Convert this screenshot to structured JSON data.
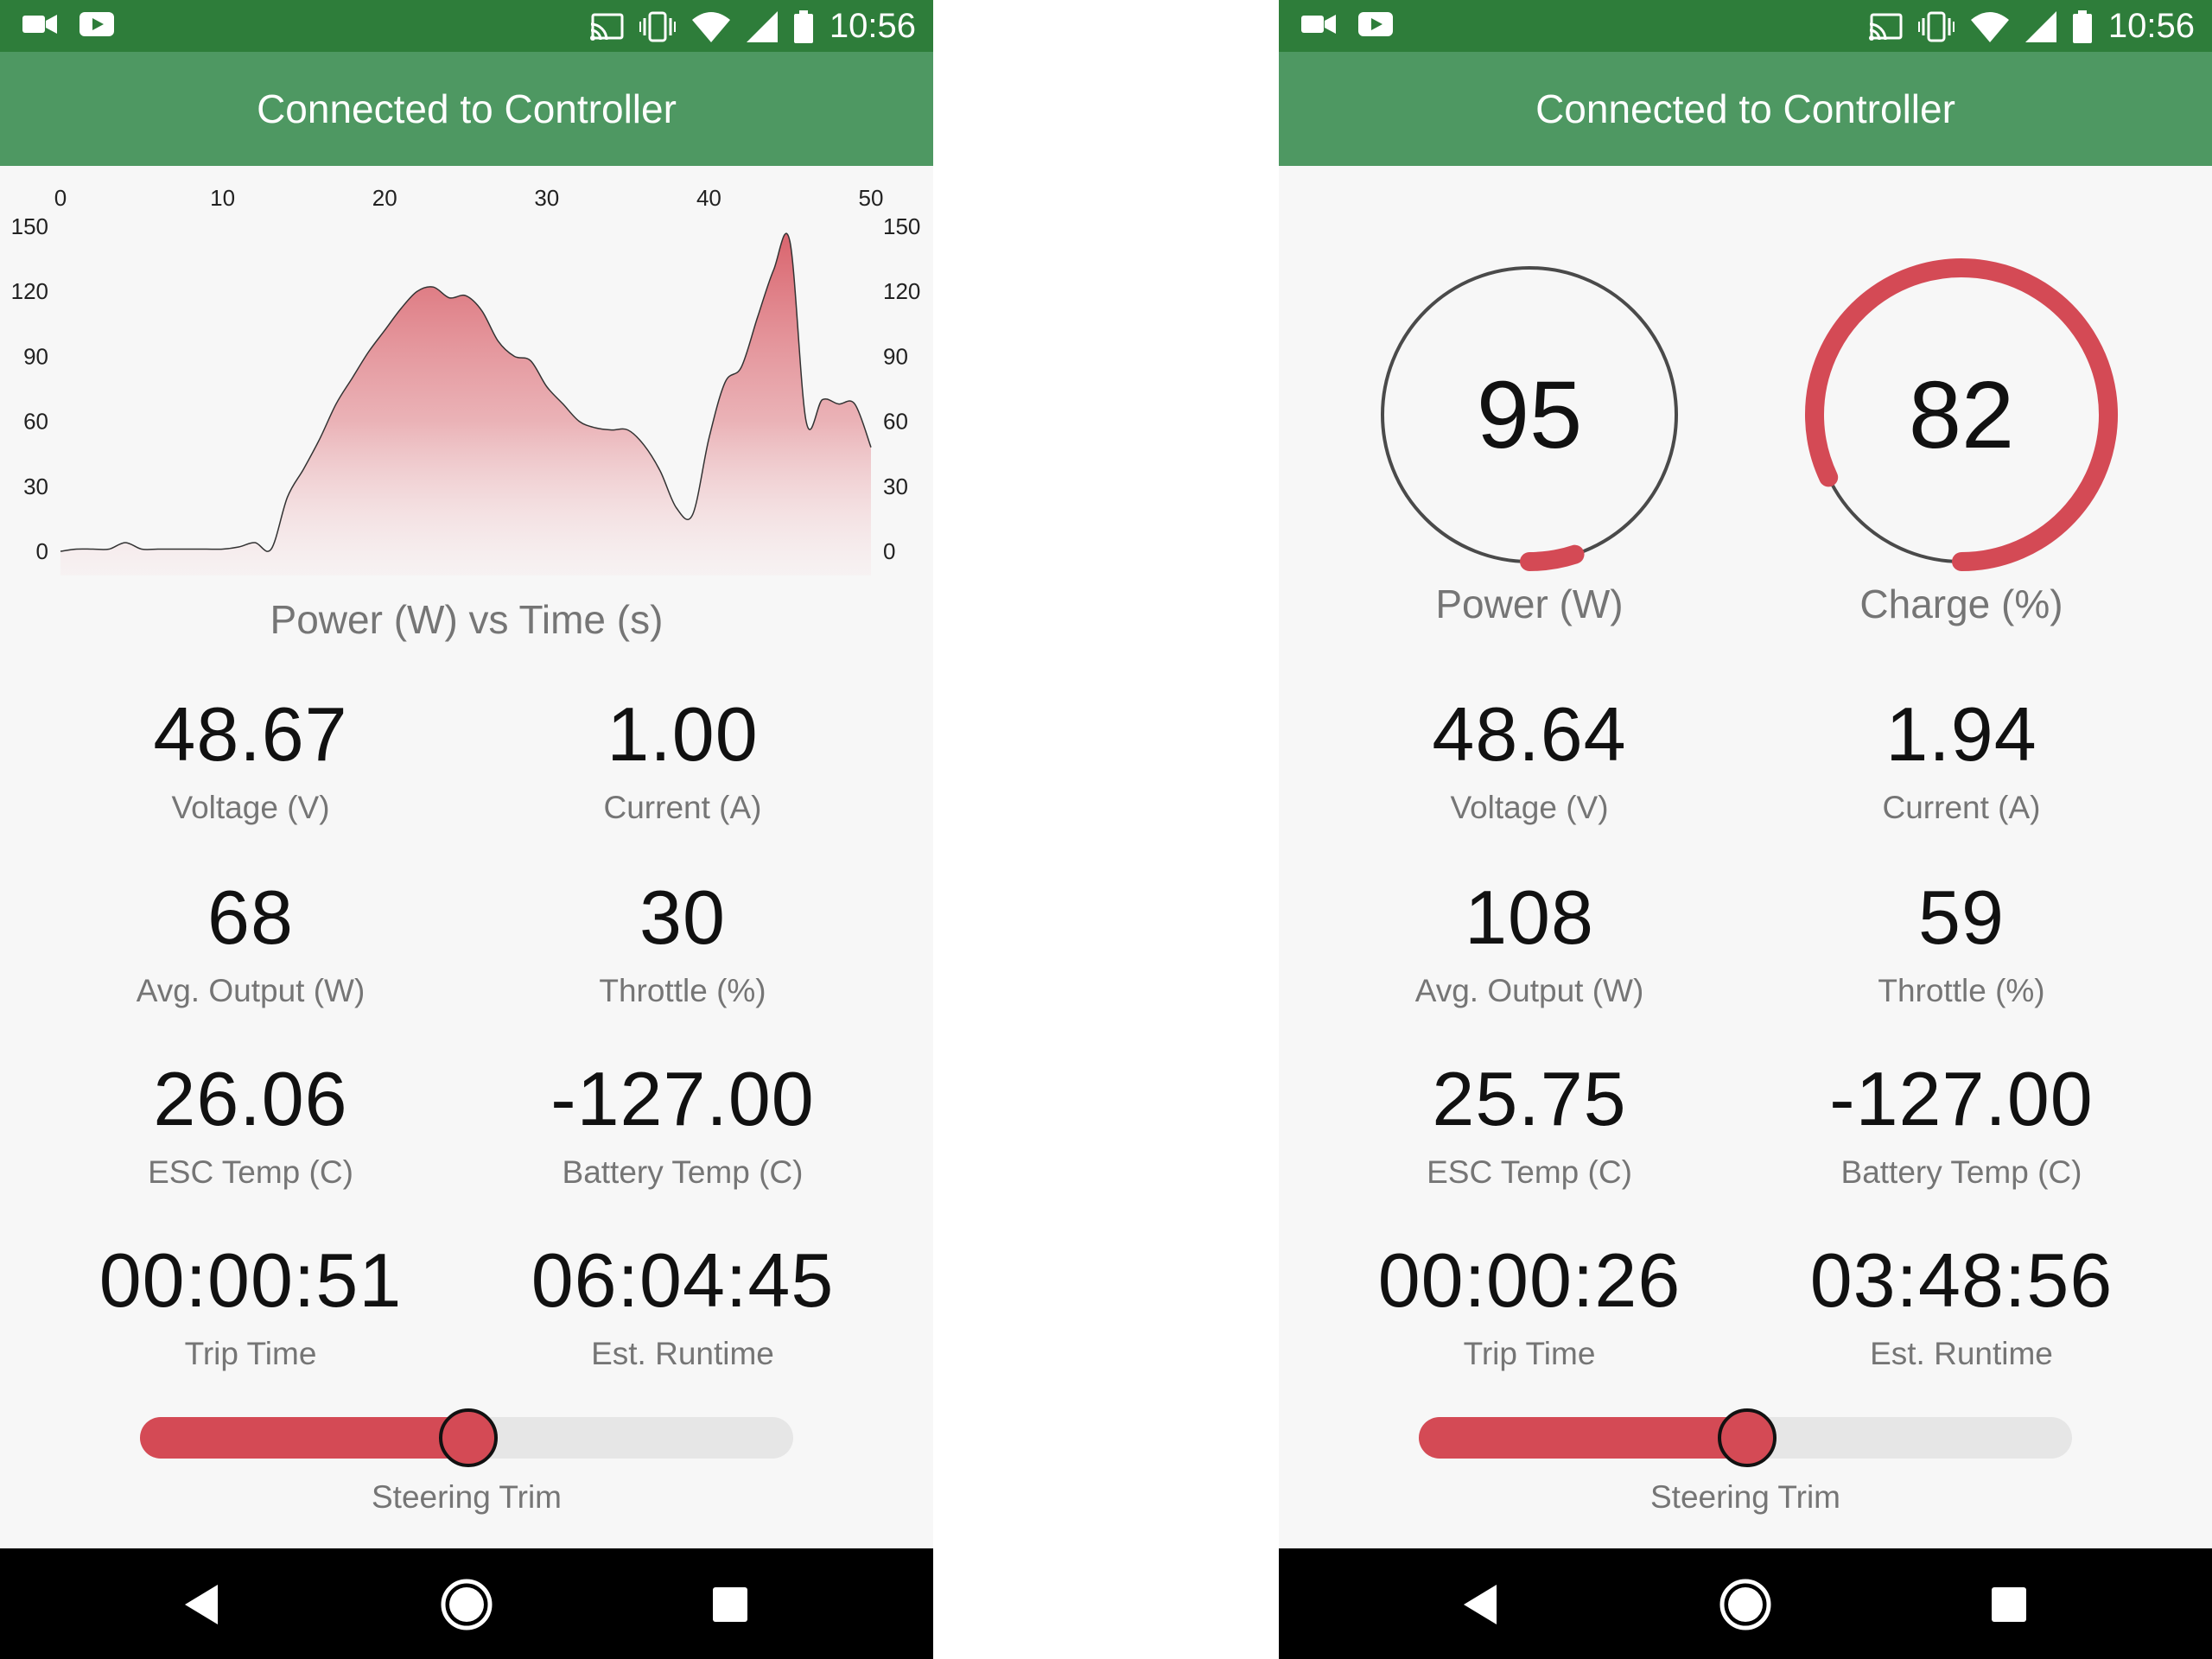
{
  "status_bar": {
    "time": "10:56",
    "left_icons": [
      "video-camera-icon",
      "youtube-icon"
    ],
    "right_icons": [
      "cast-icon",
      "vibrate-icon",
      "wifi-icon",
      "cell-signal-icon",
      "battery-icon"
    ]
  },
  "app": {
    "title": "Connected to Controller",
    "accent_color": "#d44a55",
    "header_color": "#4e9862",
    "status_color": "#2e7d3a"
  },
  "left_screen": {
    "chart_caption": "Power (W) vs Time (s)",
    "stats": [
      {
        "value": "48.67",
        "label": "Voltage (V)"
      },
      {
        "value": "1.00",
        "label": "Current (A)"
      },
      {
        "value": "68",
        "label": "Avg. Output (W)"
      },
      {
        "value": "30",
        "label": "Throttle (%)"
      },
      {
        "value": "26.06",
        "label": "ESC Temp (C)"
      },
      {
        "value": "-127.00",
        "label": "Battery Temp (C)"
      },
      {
        "value": "00:00:51",
        "label": "Trip Time"
      },
      {
        "value": "06:04:45",
        "label": "Est. Runtime"
      }
    ],
    "steering_trim": {
      "label": "Steering Trim",
      "fraction": 0.5
    }
  },
  "right_screen": {
    "gauges": [
      {
        "value": "95",
        "label": "Power (W)",
        "fill_fraction": 0.05
      },
      {
        "value": "82",
        "label": "Charge (%)",
        "fill_fraction": 0.82
      }
    ],
    "stats": [
      {
        "value": "48.64",
        "label": "Voltage (V)"
      },
      {
        "value": "1.94",
        "label": "Current (A)"
      },
      {
        "value": "108",
        "label": "Avg. Output (W)"
      },
      {
        "value": "59",
        "label": "Throttle (%)"
      },
      {
        "value": "25.75",
        "label": "ESC Temp (C)"
      },
      {
        "value": "-127.00",
        "label": "Battery Temp (C)"
      },
      {
        "value": "00:00:26",
        "label": "Trip Time"
      },
      {
        "value": "03:48:56",
        "label": "Est. Runtime"
      }
    ],
    "steering_trim": {
      "label": "Steering Trim",
      "fraction": 0.5
    }
  },
  "nav_bar": {
    "icons": [
      "back-icon",
      "home-icon",
      "recents-icon"
    ]
  },
  "chart_data": {
    "type": "area",
    "title": "Power (W) vs Time (s)",
    "xlabel": "",
    "ylabel": "",
    "xlim": [
      0,
      50
    ],
    "ylim": [
      0,
      150
    ],
    "x_ticks": [
      0,
      10,
      20,
      30,
      40,
      50
    ],
    "y_ticks": [
      0,
      30,
      60,
      90,
      120,
      150
    ],
    "x_axis_position": "top",
    "y_axis_position": "both",
    "grid": false,
    "color": "#d44a55",
    "x": [
      0,
      1,
      2,
      3,
      4,
      5,
      6,
      7,
      8,
      9,
      10,
      11,
      12,
      13,
      14,
      15,
      16,
      17,
      18,
      19,
      20,
      21,
      22,
      23,
      24,
      25,
      26,
      27,
      28,
      29,
      30,
      31,
      32,
      33,
      34,
      35,
      36,
      37,
      38,
      39,
      40,
      41,
      42,
      43,
      44,
      45,
      46,
      47,
      48,
      49,
      50
    ],
    "y": [
      0,
      1,
      1,
      1,
      4,
      1,
      1,
      1,
      1,
      1,
      1,
      2,
      4,
      1,
      25,
      38,
      52,
      68,
      80,
      92,
      102,
      112,
      120,
      122,
      117,
      118,
      111,
      97,
      90,
      88,
      76,
      68,
      60,
      57,
      56,
      56,
      49,
      37,
      20,
      17,
      52,
      78,
      85,
      108,
      130,
      143,
      60,
      70,
      68,
      68,
      48
    ]
  }
}
